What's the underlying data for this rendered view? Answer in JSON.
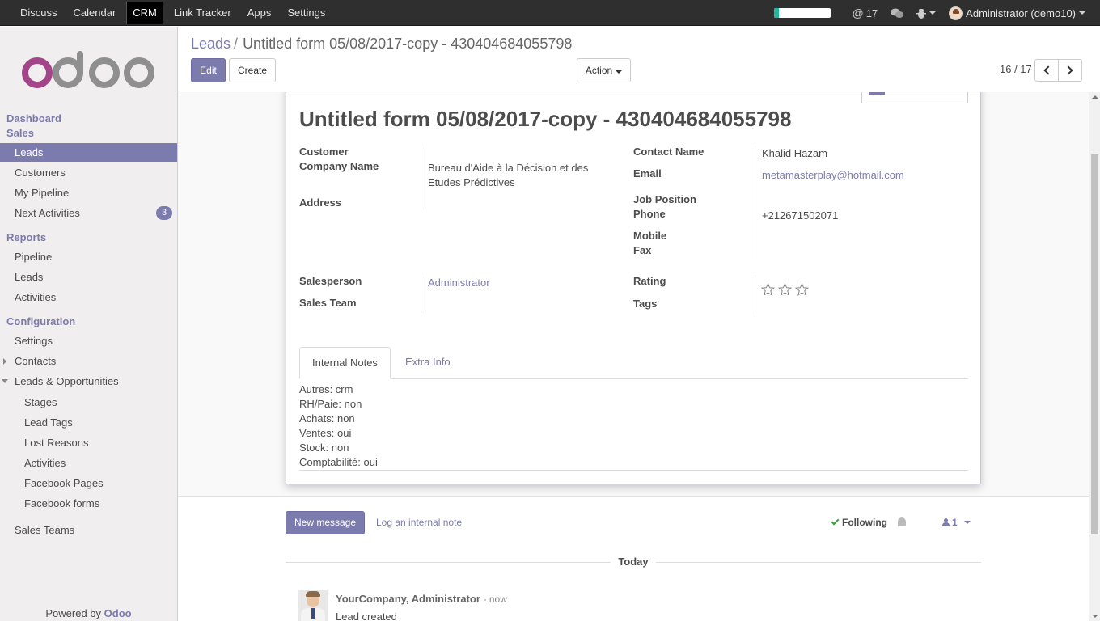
{
  "topbar": {
    "menu": [
      "Discuss",
      "Calendar",
      "CRM",
      "Link Tracker",
      "Apps",
      "Settings"
    ],
    "active": "CRM",
    "mentions_count": "17",
    "user": "Administrator (demo10)"
  },
  "sidebar": {
    "sections": {
      "dashboard": "Dashboard",
      "sales": "Sales",
      "reports": "Reports",
      "configuration": "Configuration"
    },
    "sales_items": [
      "Leads",
      "Customers",
      "My Pipeline",
      "Next Activities"
    ],
    "next_activities_badge": "3",
    "report_items": [
      "Pipeline",
      "Leads",
      "Activities"
    ],
    "config_items": [
      "Settings",
      "Contacts",
      "Leads & Opportunities"
    ],
    "leads_opps_items": [
      "Stages",
      "Lead Tags",
      "Lost Reasons",
      "Activities",
      "Facebook Pages",
      "Facebook forms"
    ],
    "sales_teams": "Sales Teams",
    "powered_prefix": "Powered by",
    "powered_brand": "Odoo"
  },
  "control_panel": {
    "breadcrumb_parent": "Leads",
    "breadcrumb_separator": "/",
    "breadcrumb_current": "Untitled form 05/08/2017-copy - 430404684055798",
    "edit_label": "Edit",
    "create_label": "Create",
    "action_label": "Action",
    "pager": "16 / 17"
  },
  "form": {
    "title": "Untitled form 05/08/2017-copy - 430404684055798",
    "labels": {
      "customer": "Customer",
      "company_name": "Company Name",
      "address": "Address",
      "contact_name": "Contact Name",
      "email": "Email",
      "job_position": "Job Position",
      "phone": "Phone",
      "mobile": "Mobile",
      "fax": "Fax",
      "salesperson": "Salesperson",
      "sales_team": "Sales Team",
      "rating": "Rating",
      "tags": "Tags"
    },
    "values": {
      "company_name_line1": "Bureau d'Aide à la Décision et des",
      "company_name_line2": "Etudes Prédictives",
      "contact_name": "Khalid Hazam",
      "email": "metamasterplay@hotmail.com",
      "phone": "+212671502071",
      "salesperson": "Administrator"
    },
    "rating_stars": 0,
    "tabs": [
      "Internal Notes",
      "Extra Info"
    ],
    "notes": [
      "Autres: crm",
      "RH/Paie: non",
      "Achats: non",
      "Ventes: oui",
      "Stock: non",
      "Comptabilité: oui"
    ]
  },
  "chatter": {
    "new_message": "New message",
    "log_note": "Log an internal note",
    "following": "Following",
    "followers_count": "1",
    "date_separator": "Today",
    "message_author": "YourCompany, Administrator",
    "message_time": "- now",
    "message_body": "Lead created"
  },
  "colors": {
    "accent": "#7c7bad",
    "topbar": "#2f2f2f"
  }
}
